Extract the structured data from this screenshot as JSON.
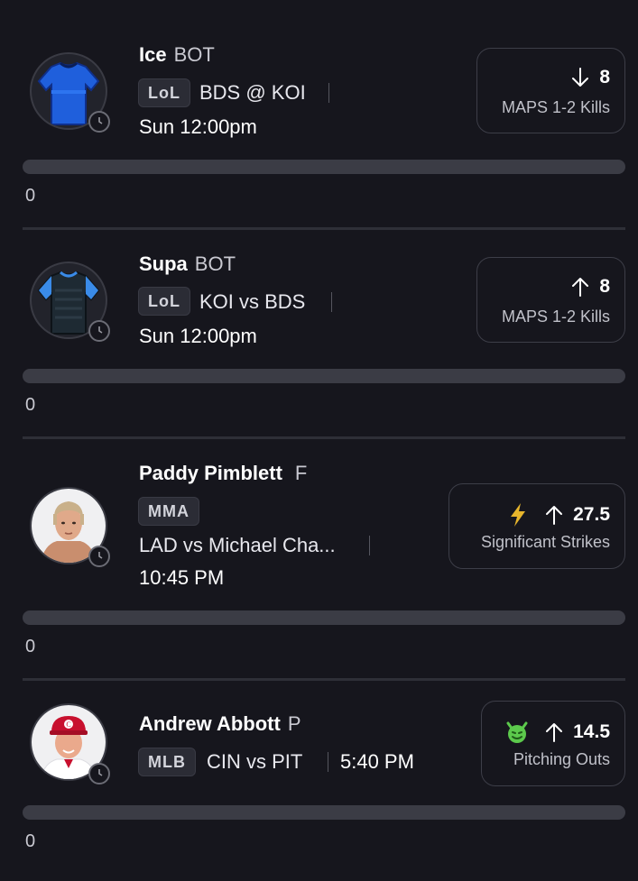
{
  "picks": [
    {
      "name": "Ice",
      "position": "BOT",
      "league": "LoL",
      "matchup": "BDS @ KOI",
      "time": "Sun 12:00pm",
      "direction": "down",
      "line": "8",
      "stat": "MAPS 1-2 Kills",
      "count": "0",
      "avatar_icon": "blue-jersey-icon"
    },
    {
      "name": "Supa",
      "position": "BOT",
      "league": "LoL",
      "matchup": "KOI vs BDS",
      "time": "Sun 12:00pm",
      "direction": "up",
      "line": "8",
      "stat": "MAPS 1-2 Kills",
      "count": "0",
      "avatar_icon": "dark-jersey-icon"
    },
    {
      "name": "Paddy Pimblett",
      "position": "F",
      "league": "MMA",
      "matchup": "LAD vs Michael Cha...",
      "time": "10:45 PM",
      "direction": "up",
      "line": "27.5",
      "stat": "Significant Strikes",
      "count": "0",
      "badge_icon": "lightning-bolt-icon",
      "avatar_icon": "player-photo"
    },
    {
      "name": "Andrew Abbott",
      "position": "P",
      "league": "MLB",
      "matchup": "CIN vs PIT",
      "time": "5:40 PM",
      "direction": "up",
      "line": "14.5",
      "stat": "Pitching Outs",
      "count": "0",
      "badge_icon": "green-devil-icon",
      "avatar_icon": "player-photo"
    }
  ],
  "colors": {
    "background": "#16161d",
    "bar": "#3b3c45",
    "bolt": "#e7b52c",
    "devil": "#5cc94c"
  }
}
